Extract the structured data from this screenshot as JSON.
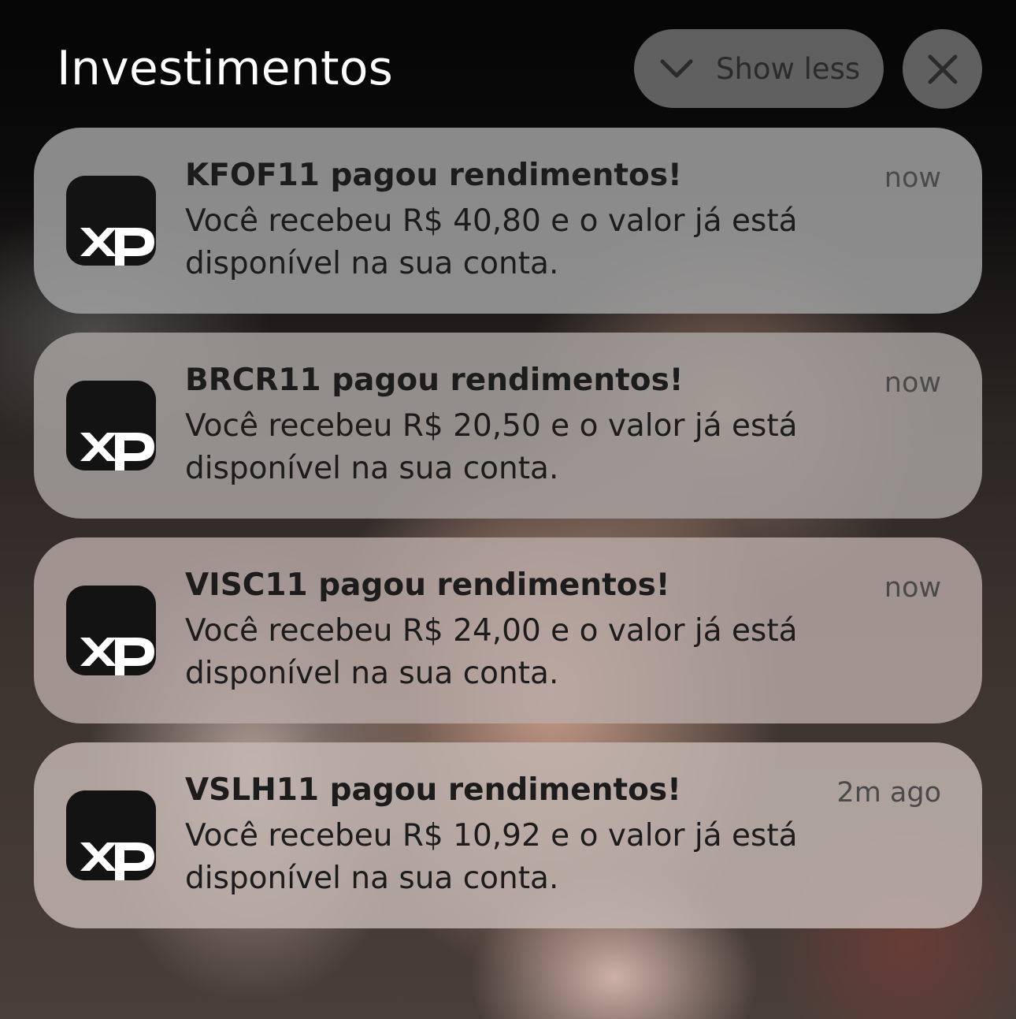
{
  "group": {
    "title": "Investimentos",
    "show_less_label": "Show less",
    "close_icon": "close-icon",
    "chevron_icon": "chevron-down-icon"
  },
  "notifications": [
    {
      "app_icon": "xp-app-icon",
      "app_icon_text": "XP",
      "title": "KFOF11 pagou rendimentos!",
      "time": "now",
      "body": "Você recebeu R$ 40,80 e o valor já está disponível na sua conta."
    },
    {
      "app_icon": "xp-app-icon",
      "app_icon_text": "XP",
      "title": "BRCR11 pagou rendimentos!",
      "time": "now",
      "body": "Você recebeu R$ 20,50 e o valor já está disponível na sua conta."
    },
    {
      "app_icon": "xp-app-icon",
      "app_icon_text": "XP",
      "title": "VISC11 pagou rendimentos!",
      "time": "now",
      "body": "Você recebeu R$ 24,00 e o valor já está disponível na sua conta."
    },
    {
      "app_icon": "xp-app-icon",
      "app_icon_text": "XP",
      "title": "VSLH11 pagou rendimentos!",
      "time": "2m ago",
      "body": "Você recebeu R$ 10,92 e o valor já está disponível na sua conta."
    }
  ],
  "colors": {
    "card_text": "#1c1c1c",
    "time_text": "#4a4a4a",
    "icon_bg": "#131313",
    "header_text": "#ffffff"
  }
}
